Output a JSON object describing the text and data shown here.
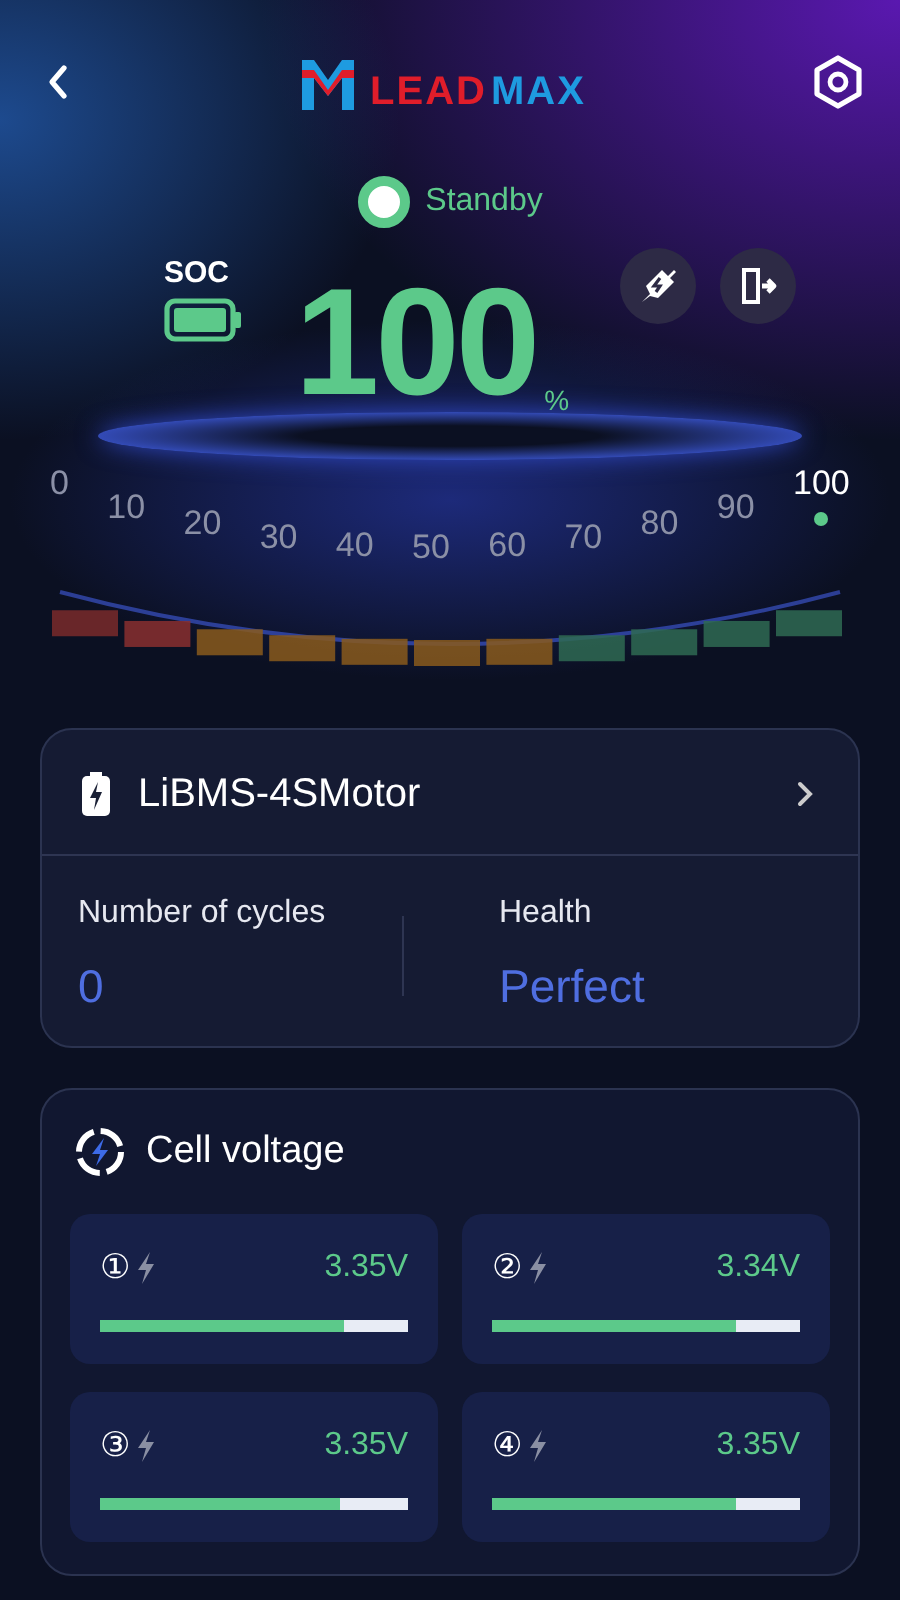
{
  "header": {
    "logo": [
      "LEAD",
      "MAX"
    ]
  },
  "status": {
    "label": "Standby"
  },
  "soc": {
    "label": "SOC",
    "value": "100",
    "unit": "%"
  },
  "gauge_ticks": [
    {
      "label": "0",
      "selected": false
    },
    {
      "label": "10",
      "selected": false
    },
    {
      "label": "20",
      "selected": false
    },
    {
      "label": "30",
      "selected": false
    },
    {
      "label": "40",
      "selected": false
    },
    {
      "label": "50",
      "selected": false
    },
    {
      "label": "60",
      "selected": false
    },
    {
      "label": "70",
      "selected": false
    },
    {
      "label": "80",
      "selected": false
    },
    {
      "label": "90",
      "selected": false
    },
    {
      "label": "100",
      "selected": true
    }
  ],
  "battery_card": {
    "name": "LiBMS-4SMotor",
    "stats": [
      {
        "label": "Number of cycles",
        "value": "0"
      },
      {
        "label": "Health",
        "value": "Perfect"
      }
    ]
  },
  "cell_voltage": {
    "title": "Cell voltage",
    "cells": [
      {
        "index": "①",
        "voltage": "3.35V",
        "level": 0.79
      },
      {
        "index": "②",
        "voltage": "3.34V",
        "level": 0.79
      },
      {
        "index": "③",
        "voltage": "3.35V",
        "level": 0.78
      },
      {
        "index": "④",
        "voltage": "3.35V",
        "level": 0.79
      }
    ]
  }
}
